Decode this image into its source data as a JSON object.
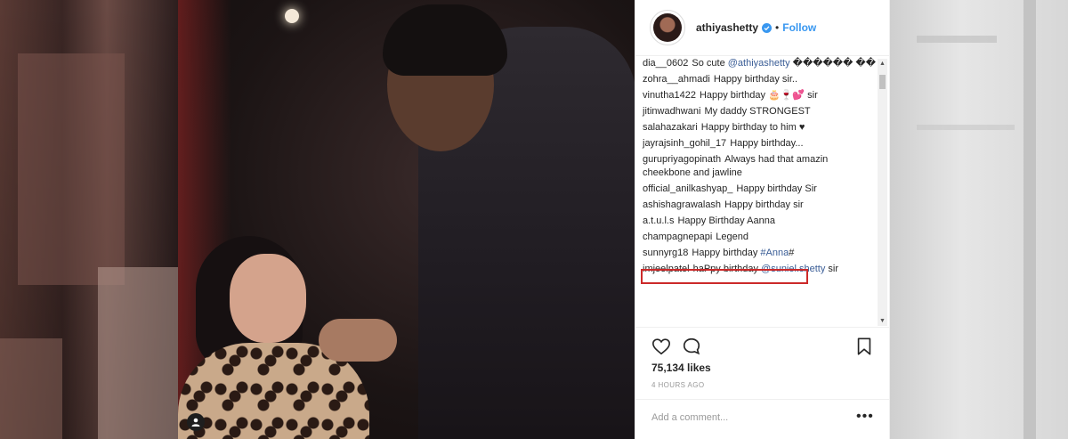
{
  "header": {
    "username": "athiyashetty",
    "follow_label": "Follow",
    "separator": "•"
  },
  "comments": [
    {
      "user": "dia__0602",
      "text": "So cute ",
      "mention": "@athiyashetty",
      "tail": " ������ ��"
    },
    {
      "user": "zohra__ahmadi",
      "text": "Happy birthday sir..",
      "mention": "",
      "tail": ""
    },
    {
      "user": "vinutha1422",
      "text": "Happy birthday 🎂🍷💕 sir",
      "mention": "",
      "tail": ""
    },
    {
      "user": "jitinwadhwani",
      "text": "My daddy STRONGEST",
      "mention": "",
      "tail": ""
    },
    {
      "user": "salahazakari",
      "text": "Happy birthday to him ♥",
      "mention": "",
      "tail": ""
    },
    {
      "user": "jayrajsinh_gohil_17",
      "text": "Happy birthday...",
      "mention": "",
      "tail": ""
    },
    {
      "user": "gurupriyagopinath",
      "text": "Always had that amazin cheekbone and jawline",
      "mention": "",
      "tail": ""
    },
    {
      "user": "official_anilkashyap_",
      "text": "Happy birthday Sir",
      "mention": "",
      "tail": ""
    },
    {
      "user": "ashishagrawalash",
      "text": "Happy birthday sir",
      "mention": "",
      "tail": ""
    },
    {
      "user": "a.t.u.l.s",
      "text": "Happy Birthday Aanna",
      "mention": "",
      "tail": ""
    },
    {
      "user": "champagnepapi",
      "text": "Legend",
      "mention": "",
      "tail": ""
    },
    {
      "user": "sunnyrg18",
      "text": "Happy birthday ",
      "mention": "#Anna",
      "tail": "#"
    },
    {
      "user": "imjeelpatel",
      "text": "haPpy birthday ",
      "mention": "@suniel.shetty",
      "tail": " sir"
    }
  ],
  "likes": "75,134 likes",
  "time": "4 HOURS AGO",
  "add_comment_placeholder": "Add a comment...",
  "more_label": "•••",
  "colors": {
    "link": "#3897f0",
    "highlight": "#cc2a2a",
    "text": "#262626"
  },
  "icons": {
    "like": "heart-icon",
    "comment": "comment-icon",
    "save": "bookmark-icon",
    "verified": "verified-badge-icon",
    "tag": "user-tag-icon"
  }
}
